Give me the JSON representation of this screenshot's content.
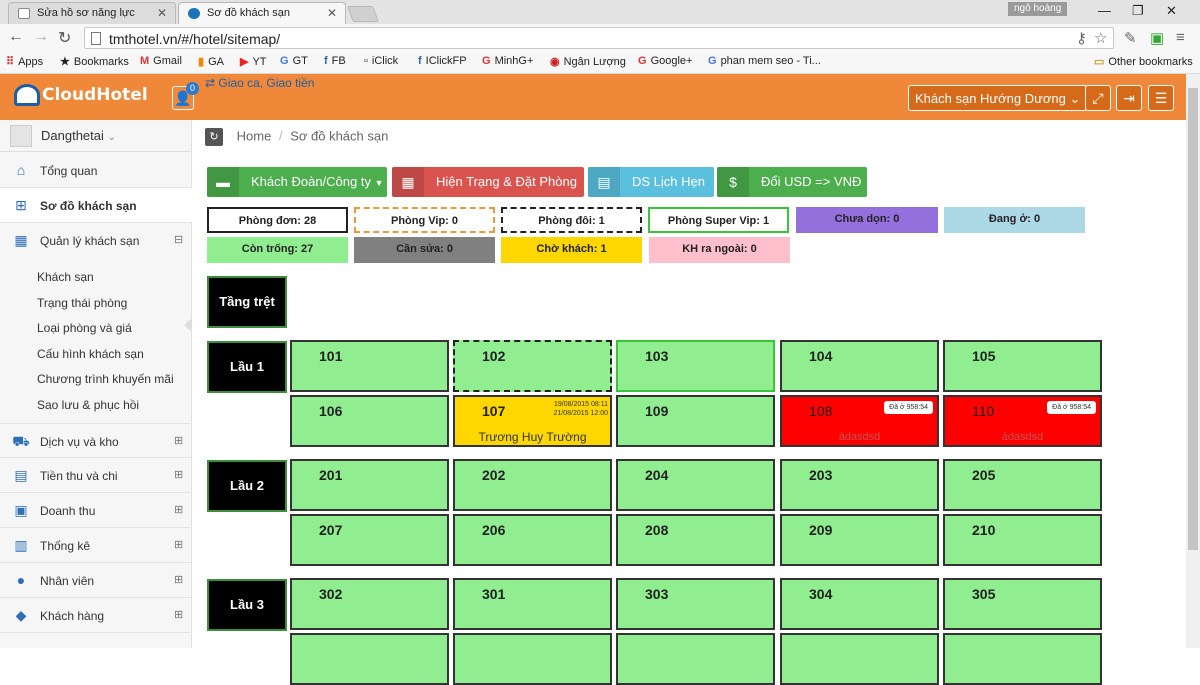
{
  "browser": {
    "tabs": [
      {
        "title": "Sửa hồ sơ năng lực"
      },
      {
        "title": "Sơ đồ khách sạn"
      }
    ],
    "profile": "ngô hoàng",
    "url": "tmthotel.vn/#/hotel/sitemap/",
    "bookmarks": [
      "Apps",
      "Bookmarks",
      "Gmail",
      "GA",
      "YT",
      "GT",
      "FB",
      "iClick",
      "IClickFP",
      "MinhG+",
      "Ngân Lượng",
      "Google+",
      "phan mem seo - Ti..."
    ],
    "other_bookmarks": "Other bookmarks"
  },
  "app": {
    "logo": "CloudHotel",
    "notif_count": "0",
    "shift_link": "Giao ca, Giao tiền",
    "hotel": "Khách sạn Hướng Dương"
  },
  "sidebar": {
    "user": "Dangthetai",
    "items": [
      {
        "label": "Tổng quan",
        "icon": "home-icon"
      },
      {
        "label": "Sơ đồ khách sạn",
        "icon": "sitemap-icon"
      },
      {
        "label": "Quản lý khách sạn",
        "icon": "building-icon"
      },
      {
        "label": "Dịch vụ và kho",
        "icon": "truck-icon"
      },
      {
        "label": "Tiền thu và chi",
        "icon": "calendar-icon"
      },
      {
        "label": "Doanh thu",
        "icon": "money-icon"
      },
      {
        "label": "Thống kê",
        "icon": "bar-chart-icon"
      },
      {
        "label": "Nhân viên",
        "icon": "user-icon"
      },
      {
        "label": "Khách hàng",
        "icon": "users-icon"
      }
    ],
    "subitems": [
      "Khách sạn",
      "Trạng thái phòng",
      "Loại phòng và giá",
      "Cấu hình khách sạn",
      "Chương trình khuyến mãi",
      "Sao lưu & phục hồi"
    ]
  },
  "breadcrumb": {
    "home": "Home",
    "sep": "/",
    "current": "Sơ đồ khách sạn"
  },
  "actions": [
    {
      "label": "Khách Đoàn/Công ty",
      "color": "#4cae4c"
    },
    {
      "label": "Hiện Trạng & Đặt Phòng",
      "color": "#d9534f"
    },
    {
      "label": "DS Lịch Hẹn",
      "color": "#5bc0de"
    },
    {
      "label": "Đổi USD => VNĐ",
      "color": "#4cae4c"
    }
  ],
  "stats": [
    {
      "label": "Phòng đơn: 28"
    },
    {
      "label": "Phòng Vip: 0"
    },
    {
      "label": "Phòng đôi: 1"
    },
    {
      "label": "Phòng Super Vip: 1"
    },
    {
      "label": "Chưa dọn: 0",
      "color": "#9370db"
    },
    {
      "label": "Đang ở: 0",
      "color": "#add8e6"
    },
    {
      "label": "Còn trống: 27",
      "color": "#90ee90"
    },
    {
      "label": "Cần sửa: 0",
      "color": "#808080"
    },
    {
      "label": "Chờ khách: 1",
      "color": "#ffd700"
    },
    {
      "label": "KH ra ngoài: 0",
      "color": "#ffc0cb"
    }
  ],
  "floors": [
    "Tầng trệt",
    "Lầu 1",
    "Lầu 2",
    "Lầu 3"
  ],
  "rooms": {
    "r101": "101",
    "r102": "102",
    "r103": "103",
    "r104": "104",
    "r105": "105",
    "r106": "106",
    "r107": "107",
    "r109": "109",
    "r108": "108",
    "r110": "110",
    "r201": "201",
    "r202": "202",
    "r204": "204",
    "r203": "203",
    "r205": "205",
    "r207": "207",
    "r206": "206",
    "r208": "208",
    "r209": "209",
    "r210": "210",
    "r302": "302",
    "r301": "301",
    "r303": "303",
    "r304": "304",
    "r305": "305"
  },
  "room107": {
    "date_in": "19/08/2015 08:11",
    "date_out": "21/08/2015 12:00",
    "guest": "Trương Huy Trường"
  },
  "room108": {
    "stay": "Đã ở 958:54",
    "guest": "ádasdsd"
  },
  "room110": {
    "stay": "Đã ở 958:54",
    "guest": "ádasdsd"
  }
}
